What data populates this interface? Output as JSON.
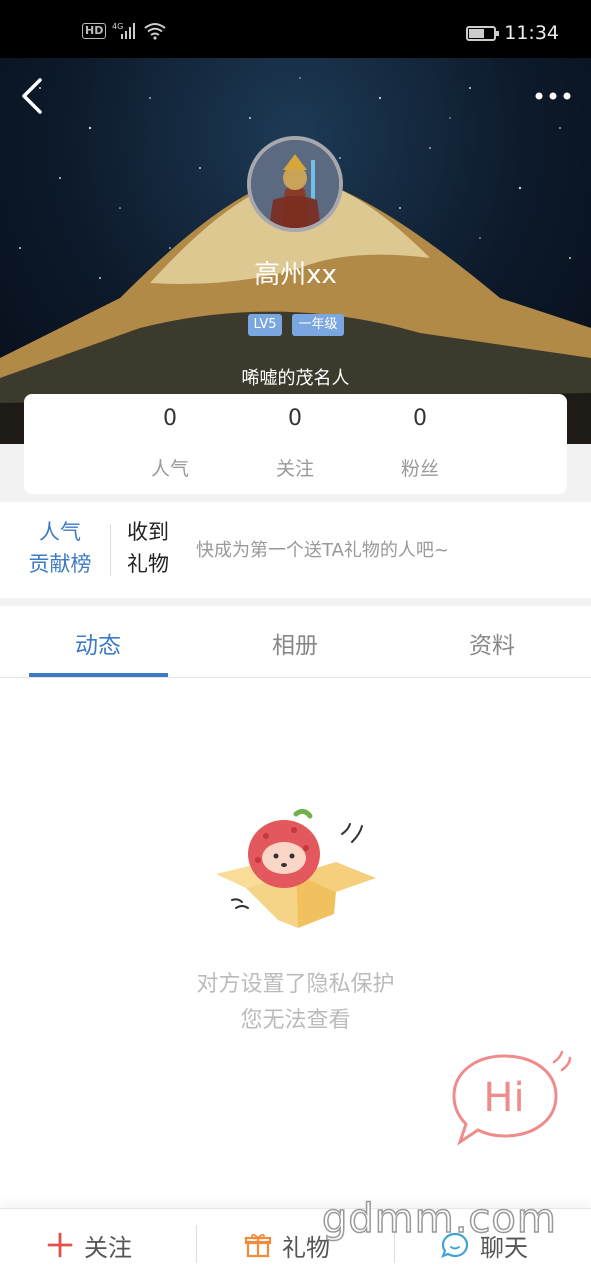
{
  "status_bar": {
    "network": "4G",
    "hd": "HD",
    "time": "11:34"
  },
  "profile": {
    "name": "高州xx",
    "badges": [
      "LV5",
      "一年级"
    ],
    "signature": "唏嘘的茂名人"
  },
  "stats": [
    {
      "value": "0",
      "label": "人气"
    },
    {
      "value": "0",
      "label": "关注"
    },
    {
      "value": "0",
      "label": "粉丝"
    }
  ],
  "gifts": {
    "rank_line1": "人气",
    "rank_line2": "贡献榜",
    "title_line1": "收到",
    "title_line2": "礼物",
    "hint": "快成为第一个送TA礼物的人吧~"
  },
  "tabs": [
    {
      "label": "动态",
      "active": true
    },
    {
      "label": "相册",
      "active": false
    },
    {
      "label": "资料",
      "active": false
    }
  ],
  "empty_state": {
    "line1": "对方设置了隐私保护",
    "line2": "您无法查看"
  },
  "hi_button": {
    "label": "Hi"
  },
  "bottom_bar": {
    "follow": "关注",
    "gift": "礼物",
    "chat": "聊天"
  },
  "watermark": "gdmm.com",
  "colors": {
    "accent": "#3f7bc4",
    "follow_red": "#e0514a",
    "gift_orange": "#f08a3c",
    "chat_blue": "#3fa3d8",
    "hi_pink": "#f08b8b"
  }
}
